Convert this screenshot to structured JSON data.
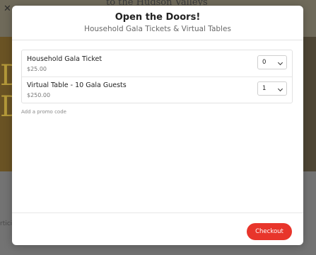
{
  "background": {
    "banner_text": "to the Hudson Valleys",
    "side_text": "rticip"
  },
  "modal": {
    "title": "Open the Doors!",
    "subtitle": "Household Gala Tickets & Virtual Tables",
    "tickets": [
      {
        "name": "Household Gala Ticket",
        "price": "$25.00",
        "quantity": "0"
      },
      {
        "name": "Virtual Table - 10 Gala Guests",
        "price": "$250.00",
        "quantity": "1"
      }
    ],
    "promo_link": "Add a promo code",
    "checkout_label": "Checkout"
  },
  "colors": {
    "accent": "#e8352b",
    "overlay": "#6c6c6c",
    "modal_bg": "#ffffff"
  },
  "icons": {
    "select_chevron": "chevron-down-icon",
    "close": "close-icon"
  }
}
